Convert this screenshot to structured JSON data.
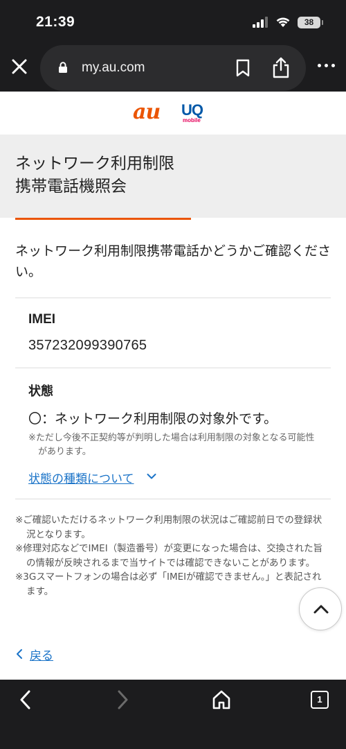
{
  "status_bar": {
    "time": "21:39",
    "battery": "38"
  },
  "browser": {
    "url": "my.au.com",
    "tab_count": "1"
  },
  "logos": {
    "au": "au",
    "uq": "UQ",
    "uq_sub": "mobile"
  },
  "page": {
    "title_line1": "ネットワーク利用制限",
    "title_line2": "携帯電話機照会",
    "intro": "ネットワーク利用制限携帯電話かどうかご確認ください。",
    "imei_label": "IMEI",
    "imei_value": "357232099390765",
    "status_label": "状態",
    "status_value": "〇：ネットワーク利用制限の対象外です。",
    "status_note": "※ただし今後不正契約等が判明した場合は利用制限の対象となる可能性があります。",
    "types_link": "状態の種類について",
    "notes": [
      "※ご確認いただけるネットワーク利用制限の状況はご確認前日での登録状況となります。",
      "※修理対応などでIMEI（製造番号）が変更になった場合は、交換された旨の情報が反映されるまで当サイトでは確認できないことがあります。",
      "※3Gスマートフォンの場合は必ず「IMEIが確認できません。」と表記されます。"
    ],
    "back_link": "戻る"
  },
  "colors": {
    "accent": "#eb5505",
    "link": "#1a73c8",
    "chrome": "#1c1c1e"
  },
  "icons": [
    "signal-icon",
    "wifi-icon",
    "close-icon",
    "lock-icon",
    "bookmark-icon",
    "share-icon",
    "more-icon",
    "chevron-down-icon",
    "chevron-up-icon",
    "chevron-left-icon",
    "chevron-right-icon",
    "home-icon"
  ]
}
